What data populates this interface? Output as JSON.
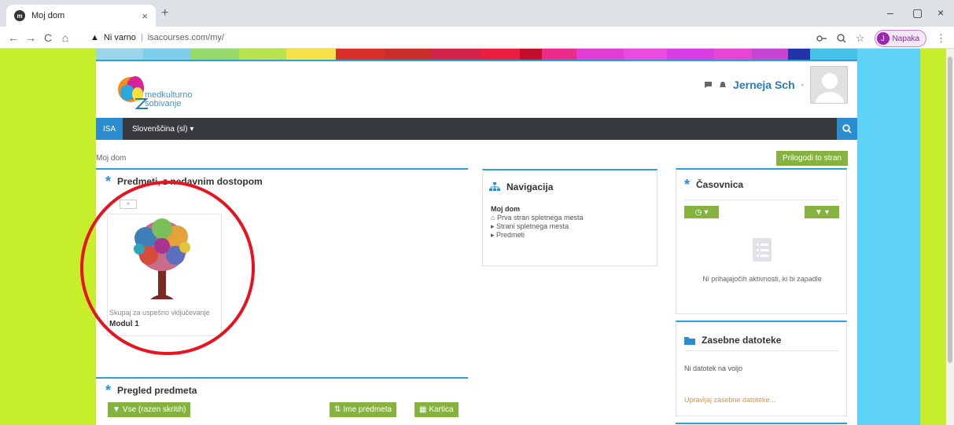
{
  "browser": {
    "tab_title": "Moj dom",
    "tab_close": "×",
    "new_tab": "+",
    "nav_back": "←",
    "nav_forward": "→",
    "nav_reload": "C",
    "nav_home": "⌂",
    "security_label": "Ni varno",
    "separator": "|",
    "url": "isacourses.com/my/",
    "profile_initial": "J",
    "profile_label": "Napaka",
    "minimize": "–",
    "maximize": "▢",
    "close": "×"
  },
  "site": {
    "logo_line1": "medkulturno",
    "logo_line2": "sobivanje",
    "brand": "ISA",
    "language": "Slovenščina (sl) ▾",
    "user_name": "Jerneja Sch",
    "user_suffix": "-",
    "breadcrumb": "Moj dom",
    "customize_label": "Prilogodi to stran"
  },
  "courses_block": {
    "title": "Predmeti, z nedavnim dostopom",
    "paginate": "»",
    "course_subtitle": "Skupaj za uspešno vključevanje",
    "course_name": "Modul 1"
  },
  "overview_block": {
    "title": "Pregled predmeta",
    "filter_label": "Vse (razen skritih)",
    "sort_label": "Ime predmeta",
    "view_label": "Kartica"
  },
  "navigation_block": {
    "title": "Navigacija",
    "root": "Moj dom",
    "items": [
      "Prva stran spletnega mesta",
      "Strani spletnega mesta",
      "Predmeti"
    ]
  },
  "timeline_block": {
    "title": "Časovnica",
    "empty_message": "Ni prihajajočih aktivnosti, ki bi zapadle"
  },
  "files_block": {
    "title": "Zasebne datoteke",
    "empty_message": "Ni datotek na voljo",
    "manage_link": "Upravljaj zasebne datoteke..."
  },
  "colors": {
    "accent_blue": "#2b8dd0",
    "green_button": "#86b33f",
    "navbar_dark": "#373a3c",
    "lime_bg": "#c7ee2a",
    "cyan_bg": "#5ed3f5",
    "highlight_red": "#e8131f"
  }
}
